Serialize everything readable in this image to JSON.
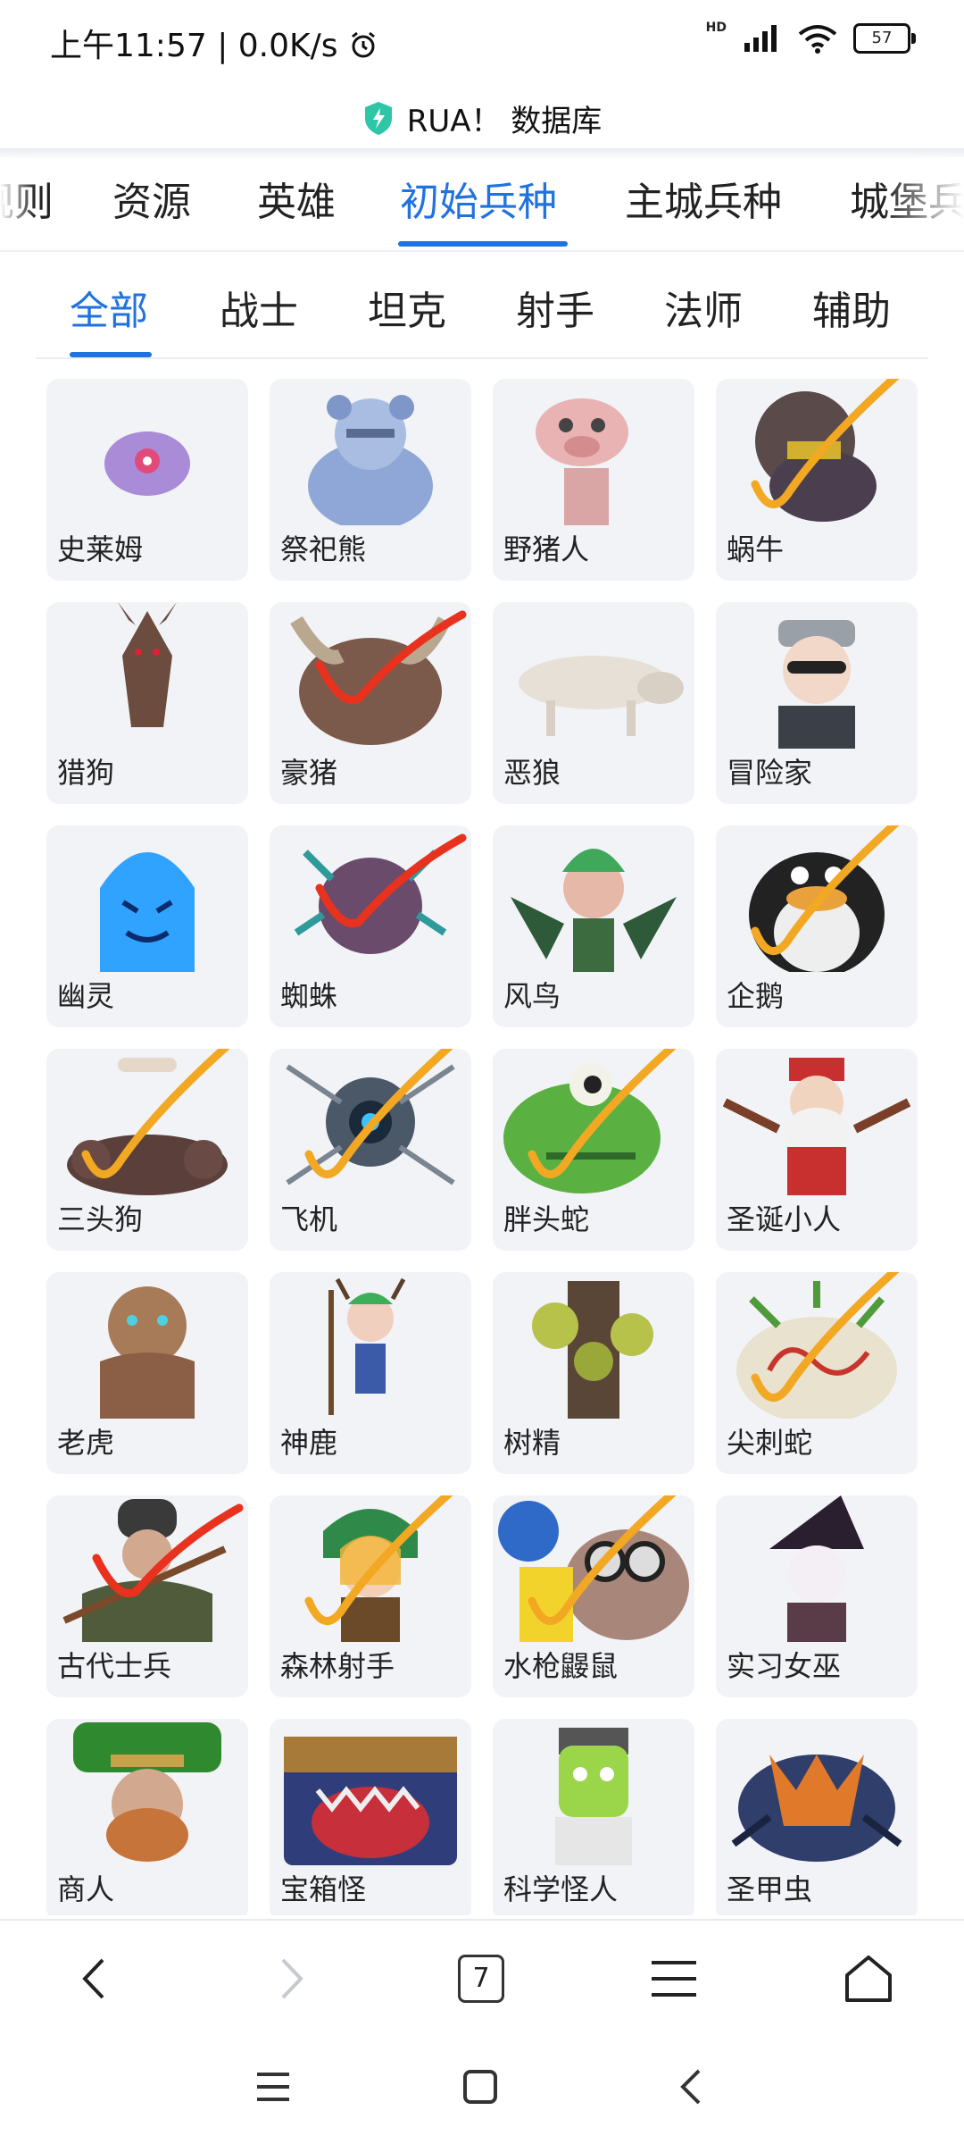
{
  "status_bar": {
    "time": "上午11:57",
    "speed": "0.0K/s",
    "hd": "HD",
    "battery": "57"
  },
  "app": {
    "title": "RUA！ 数据库",
    "accent": "#1f72e0"
  },
  "primary_tabs": [
    "规则",
    "资源",
    "英雄",
    "初始兵种",
    "主城兵种",
    "城堡兵"
  ],
  "primary_active": "初始兵种",
  "secondary_tabs": [
    "全部",
    "战士",
    "坦克",
    "射手",
    "法师",
    "辅助"
  ],
  "secondary_active": "全部",
  "units": [
    {
      "name": "史莱姆",
      "icon": "slime-icon",
      "mark": "none"
    },
    {
      "name": "祭祀熊",
      "icon": "bear-icon",
      "mark": "none"
    },
    {
      "name": "野猪人",
      "icon": "pig-icon",
      "mark": "none"
    },
    {
      "name": "蜗牛",
      "icon": "snail-icon",
      "mark": "orange"
    },
    {
      "name": "猎狗",
      "icon": "hound-icon",
      "mark": "none"
    },
    {
      "name": "豪猪",
      "icon": "boar-icon",
      "mark": "red"
    },
    {
      "name": "恶狼",
      "icon": "wolf-icon",
      "mark": "none"
    },
    {
      "name": "冒险家",
      "icon": "adventurer-icon",
      "mark": "none"
    },
    {
      "name": "幽灵",
      "icon": "ghost-icon",
      "mark": "none"
    },
    {
      "name": "蜘蛛",
      "icon": "spider-icon",
      "mark": "red"
    },
    {
      "name": "风鸟",
      "icon": "harpy-icon",
      "mark": "none"
    },
    {
      "name": "企鹅",
      "icon": "penguin-icon",
      "mark": "orange"
    },
    {
      "name": "三头狗",
      "icon": "cerberus-icon",
      "mark": "orange"
    },
    {
      "name": "飞机",
      "icon": "drone-icon",
      "mark": "orange"
    },
    {
      "name": "胖头蛇",
      "icon": "fat-snake-icon",
      "mark": "orange"
    },
    {
      "name": "圣诞小人",
      "icon": "santa-icon",
      "mark": "none"
    },
    {
      "name": "老虎",
      "icon": "tiger-icon",
      "mark": "none"
    },
    {
      "name": "神鹿",
      "icon": "deer-icon",
      "mark": "none"
    },
    {
      "name": "树精",
      "icon": "treant-icon",
      "mark": "none"
    },
    {
      "name": "尖刺蛇",
      "icon": "spike-snake-icon",
      "mark": "orange"
    },
    {
      "name": "古代士兵",
      "icon": "ancient-soldier-icon",
      "mark": "red"
    },
    {
      "name": "森林射手",
      "icon": "forest-archer-icon",
      "mark": "orange"
    },
    {
      "name": "水枪鼹鼠",
      "icon": "water-mole-icon",
      "mark": "orange"
    },
    {
      "name": "实习女巫",
      "icon": "witch-icon",
      "mark": "none"
    },
    {
      "name": "商人",
      "icon": "merchant-icon",
      "mark": "none"
    },
    {
      "name": "宝箱怪",
      "icon": "mimic-icon",
      "mark": "none"
    },
    {
      "name": "科学怪人",
      "icon": "frankenstein-icon",
      "mark": "none"
    },
    {
      "name": "圣甲虫",
      "icon": "scarab-icon",
      "mark": "none"
    }
  ],
  "browser_nav": {
    "tab_count": "7"
  }
}
